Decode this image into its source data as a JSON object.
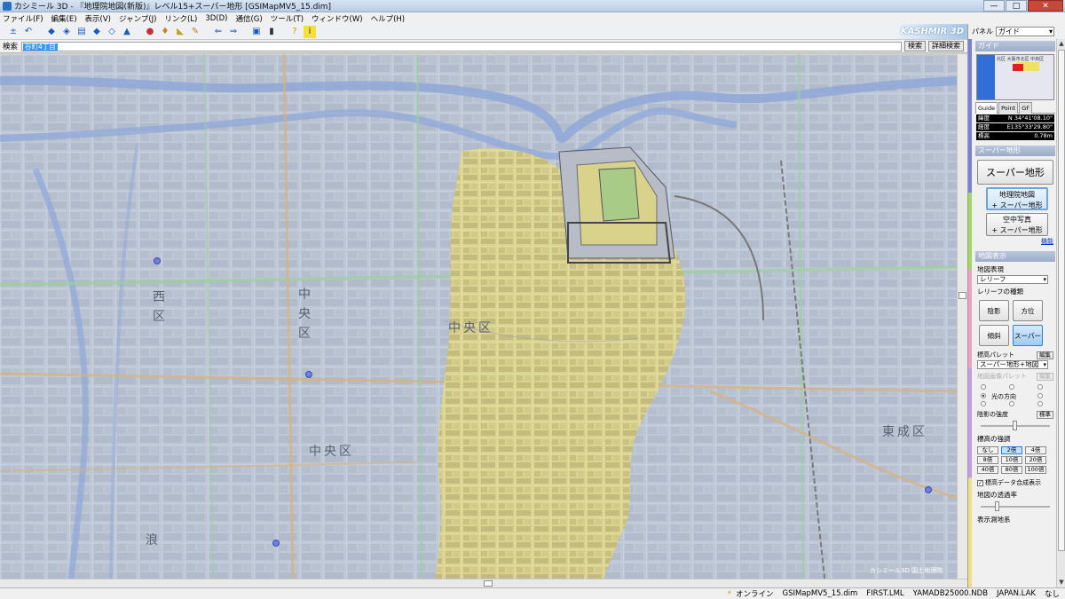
{
  "window": {
    "title": "カシミール 3D - 『地理院地図(新版)』レベル15+スーパー地形 [GSIMapMV5_15.dim]",
    "minimize": "—",
    "maximize": "□",
    "close": "✕"
  },
  "menu": [
    "ファイル(F)",
    "編集(E)",
    "表示(V)",
    "ジャンプ(J)",
    "リンク(L)",
    "3D(D)",
    "通信(G)",
    "ツール(T)",
    "ウィンドウ(W)",
    "ヘルプ(H)"
  ],
  "toolbar": {
    "logo": "KASHMIR 3D",
    "icons": [
      "zoom-search-icon",
      "back-icon",
      "map-open-icon",
      "map-save-icon",
      "map-print-icon",
      "map-copy-icon",
      "map-layer-icon",
      "map-shade-icon",
      "waypoint-icon",
      "route-icon",
      "ruler-icon",
      "pencil-icon",
      "arrow-left-icon",
      "arrow-right-icon",
      "camera-icon",
      "gps-icon",
      "help-icon",
      "info-icon"
    ]
  },
  "search": {
    "label": "検索",
    "value": "谷町4丁目",
    "search_button": "検索",
    "detail_button": "詳細検索"
  },
  "map": {
    "wards": [
      {
        "text": "中央区",
        "orientation": "h"
      },
      {
        "text": "中央区",
        "orientation": "v"
      },
      {
        "text": "中央区",
        "orientation": "h"
      },
      {
        "text": "西区",
        "orientation": "v"
      },
      {
        "text": "東成区",
        "orientation": "h"
      },
      {
        "text": "浪",
        "orientation": "v"
      }
    ],
    "credit": "カシミール3D 国土地理院"
  },
  "panel": {
    "label": "パネル",
    "mode": "ガイド",
    "guide": {
      "header": "ガイド",
      "map_text": "北区 大阪市北区 中央区",
      "tabs": [
        "Guide",
        "Point",
        "GF"
      ],
      "lat_label": "緯度",
      "lat": "N 34°41'08.10\"",
      "lon_label": "経度",
      "lon": "E135°33'29.80\"",
      "elev_label": "標高",
      "elev": "0.78m"
    },
    "super": {
      "header": "スーパー地形",
      "main_button": "スーパー地形",
      "gsi_line1": "地理院地図",
      "gsi_line2": "+ スーパー地形",
      "aerial_line1": "空中写真",
      "aerial_line2": "+ スーパー地形",
      "link": "機能"
    },
    "display": {
      "header": "地図表示",
      "expr_label": "地図表現",
      "expr_value": "レリーフ",
      "relief_label": "レリーフの種類",
      "buttons": [
        "陰影",
        "方位",
        "傾斜",
        "スーパー"
      ],
      "palette_label": "標高パレット",
      "edit": "編集",
      "palette_value": "スーパー地形+地図",
      "img_palette_label": "地図画像パレット",
      "light_dir": "光の方向",
      "shade_label": "陰影の強度",
      "standard": "標準",
      "elev_label": "標高の強調",
      "elev_options": [
        "なし",
        "2倍",
        "4倍",
        "8倍",
        "10倍",
        "20倍",
        "40倍",
        "80倍",
        "100倍"
      ],
      "elev_selected": "2倍",
      "composite": "標高データ合成表示",
      "opacity": "地図の透過率",
      "survey": "表示測地系"
    }
  },
  "status": {
    "online": "オンライン",
    "files": [
      "GSIMapMV5_15.dim",
      "FIRST.LML",
      "YAMADB25000.NDB",
      "JAPAN.LAK",
      "なし"
    ]
  },
  "colors": {
    "terrain_yellow": "#e4dc86",
    "water_blue": "#8fa8d8",
    "road_green": "#9ccf9c"
  }
}
